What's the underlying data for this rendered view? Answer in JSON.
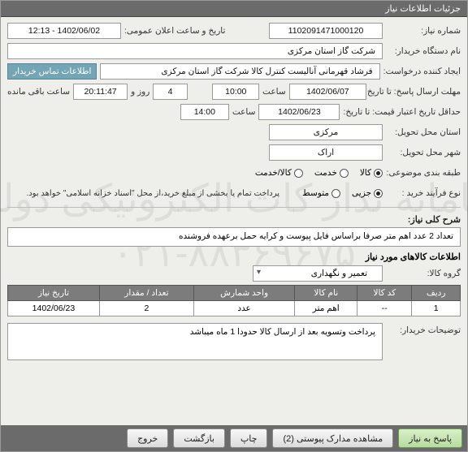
{
  "header": {
    "title": "جزئیات اطلاعات نیاز"
  },
  "watermark": {
    "line1": "سامانه تدار کات الکترونیکی دولت",
    "line2": "۰۲۱-۸۸۳۶۹۶۷۵"
  },
  "labels": {
    "need_number": "شماره نیاز:",
    "announce_datetime": "تاریخ و ساعت اعلان عمومی:",
    "buyer_org": "نام دستگاه خریدار:",
    "request_creator": "ایجاد کننده درخواست:",
    "buyer_contact": "اطلاعات تماس خریدار",
    "reply_deadline": "مهلت ارسال پاسخ: تا تاریخ:",
    "time": "ساعت",
    "day_and": "روز و",
    "time_remaining": "ساعت باقی مانده",
    "price_validity": "حداقل تاریخ اعتبار قیمت: تا تاریخ:",
    "location_province": "استان محل تحویل:",
    "location_city": "شهر محل تحویل:",
    "subject_class": "طبقه بندی موضوعی:",
    "purchase_process": "نوع فرآیند خرید :",
    "payment_note": "پرداخت تمام یا بخشی از مبلغ خرید،از محل \"اسناد خزانه اسلامی\" خواهد بود.",
    "need_summary_title": "شرح کلی نیاز:",
    "items_info_title": "اطلاعات کالاهای مورد نیاز",
    "goods_group": "گروه کالا:",
    "buyer_notes": "توضیحات خریدار:"
  },
  "fields": {
    "need_number": "1102091471000120",
    "announce_datetime": "1402/06/02 - 12:13",
    "buyer_org": "شرکت گاز استان مرکزی",
    "request_creator": "فرشاد قهرمانی آنالیست کنترل کالا شرکت گاز استان مرکزی",
    "reply_date": "1402/06/07",
    "reply_time": "10:00",
    "remaining_days": "4",
    "remaining_time": "20:11:47",
    "price_validity_date": "1402/06/23",
    "price_validity_time": "14:00",
    "province": "مرکزی",
    "city": "اراک",
    "need_summary": "تعداد 2 عدد اهم متر صرفا براساس فایل پیوست و کرایه حمل برعهده فروشنده",
    "goods_group": "تعمیر و نگهداری",
    "buyer_notes": "پرداخت وتسویه بعد از ارسال کالا حدودا 1 ماه میباشد"
  },
  "radios": {
    "subject": {
      "options": [
        "کالا",
        "خدمت",
        "کالا/خدمت"
      ],
      "selected": 0
    },
    "purchase": {
      "options": [
        "جزیی",
        "متوسط"
      ],
      "selected": 0
    }
  },
  "table": {
    "headers": [
      "ردیف",
      "کد کالا",
      "نام کالا",
      "واحد شمارش",
      "تعداد / مقدار",
      "تاریخ نیاز"
    ],
    "rows": [
      {
        "idx": "1",
        "code": "--",
        "name": "اهم متر",
        "unit": "عدد",
        "qty": "2",
        "date": "1402/06/23"
      }
    ]
  },
  "buttons": {
    "reply": "پاسخ به نیاز",
    "attachments": "مشاهده مدارک پیوستی (2)",
    "print": "چاپ",
    "back": "بازگشت",
    "exit": "خروج"
  }
}
